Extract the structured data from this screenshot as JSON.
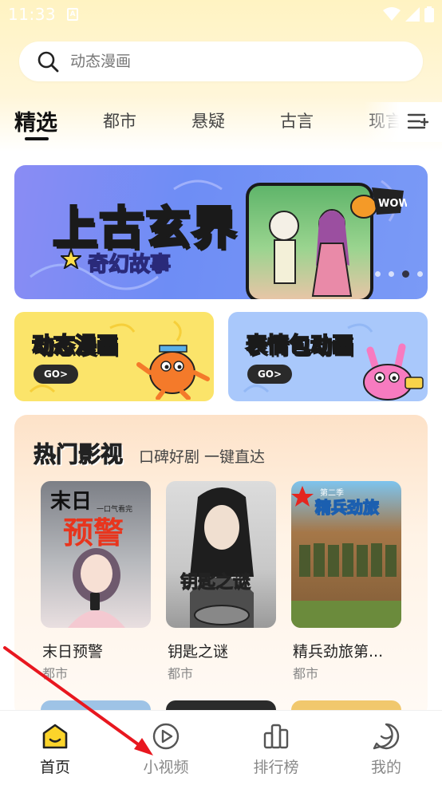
{
  "status_bar": {
    "time": "11:33",
    "app_badge": "A"
  },
  "search": {
    "placeholder": "动态漫画"
  },
  "tabs": [
    {
      "label": "精选",
      "active": true
    },
    {
      "label": "都市"
    },
    {
      "label": "悬疑"
    },
    {
      "label": "古言"
    },
    {
      "label": "现言"
    }
  ],
  "banner": {
    "title": "上古玄界",
    "subtitle": "奇幻故事",
    "badge": "WOW"
  },
  "promos": [
    {
      "label": "动态漫画",
      "go": "GO>",
      "color": "#fbe46a"
    },
    {
      "label": "表情包动画",
      "go": "GO>",
      "color": "#a9c8fb"
    }
  ],
  "hot": {
    "title": "热门影视",
    "subtitle": "口碑好剧 一键直达",
    "items": [
      {
        "title": "末日预警",
        "genre": "都市",
        "poster_text": "末日",
        "poster_big": "预警",
        "poster_small": "一口气看完"
      },
      {
        "title": "钥匙之谜",
        "genre": "都市",
        "poster_text": "钥匙之谜"
      },
      {
        "title": "精兵劲旅第...",
        "genre": "都市",
        "poster_text": "精兵劲旅",
        "poster_small": "第二季"
      }
    ]
  },
  "bottom_nav": [
    {
      "label": "首页",
      "icon": "home-icon",
      "active": true
    },
    {
      "label": "小视频",
      "icon": "play-icon"
    },
    {
      "label": "排行榜",
      "icon": "ranking-icon"
    },
    {
      "label": "我的",
      "icon": "profile-icon"
    }
  ],
  "colors": {
    "accent": "#fbd42b",
    "banner_bg": "#7a8cf5",
    "arrow": "#e8171f"
  }
}
